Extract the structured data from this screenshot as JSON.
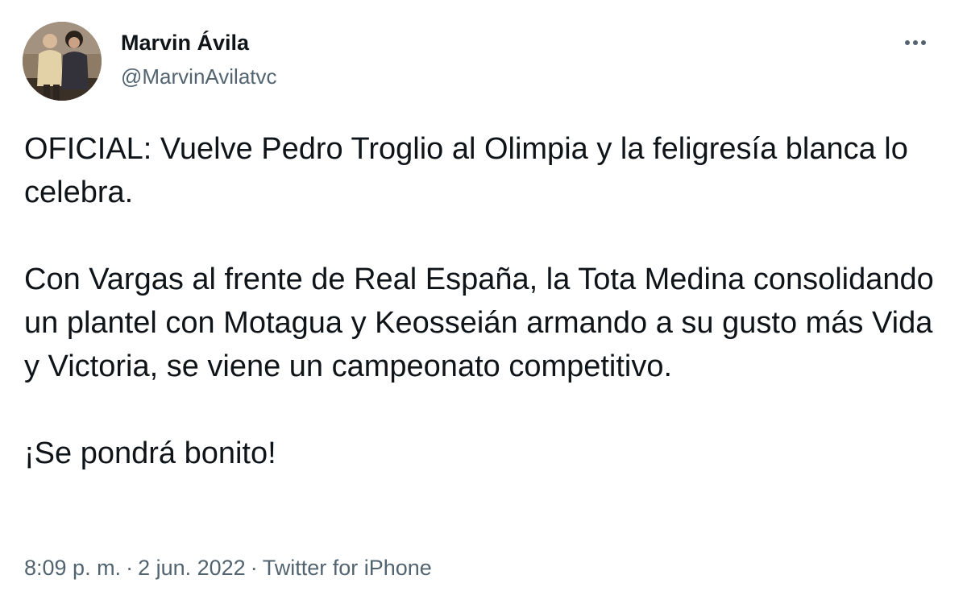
{
  "author": {
    "name": "Marvin Ávila",
    "handle": "@MarvinAvilatvc",
    "avatar_icon": "profile-photo"
  },
  "menu": {
    "more_icon": "more-horizontal-icon"
  },
  "tweet": {
    "paragraphs": [
      "OFICIAL: Vuelve Pedro Troglio al Olimpia y la feligresía blanca lo celebra.",
      "Con Vargas al frente de Real España, la Tota Medina consolidando un plantel con Motagua y Keosseián armando a su gusto más Vida y Victoria, se viene un campeonato competitivo.",
      "¡Se pondrá bonito!"
    ]
  },
  "meta": {
    "time": "8:09 p. m.",
    "date": "2 jun. 2022",
    "source": "Twitter for iPhone",
    "separator": "·"
  },
  "colors": {
    "text": "#0f1419",
    "secondary": "#536471",
    "background": "#ffffff"
  }
}
